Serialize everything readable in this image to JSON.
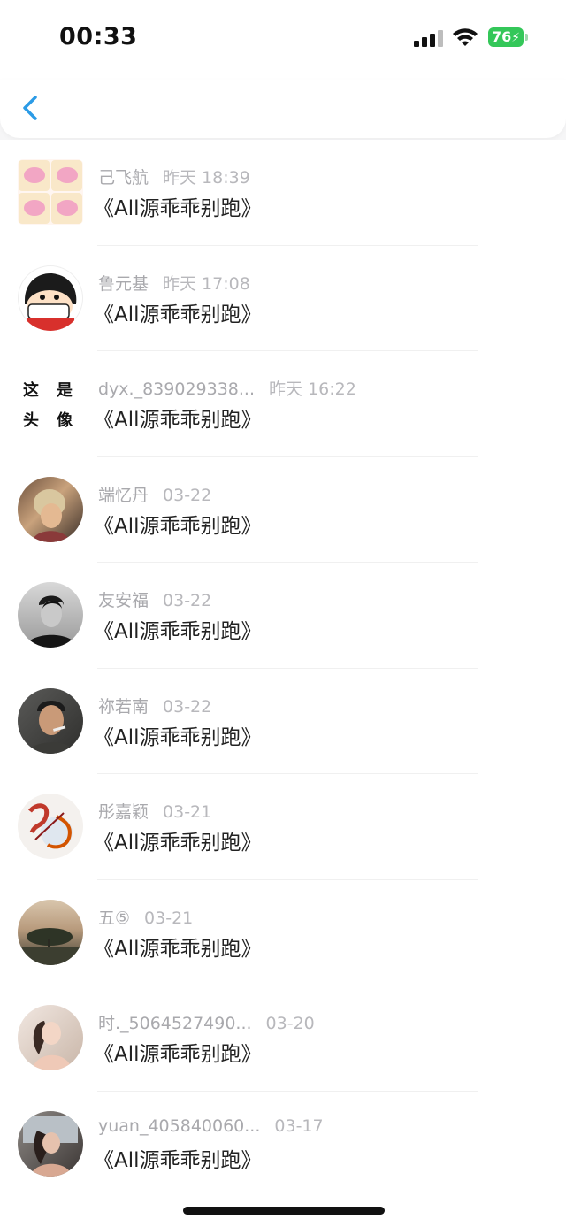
{
  "status_bar": {
    "time": "00:33",
    "battery": "76",
    "icons": [
      "signal-icon",
      "wifi-icon",
      "battery-charging-icon"
    ]
  },
  "nav": {
    "back_icon": "chevron-left-icon",
    "accent_color": "#2b9be6"
  },
  "messages": [
    {
      "name": "己飞航",
      "date": "昨天 18:39",
      "text": "《All源乖乖别跑》"
    },
    {
      "name": "鲁元基",
      "date": "昨天 17:08",
      "text": "《All源乖乖别跑》"
    },
    {
      "name": "dyx._839029338...",
      "date": "昨天 16:22",
      "text": "《All源乖乖别跑》",
      "avatar_text": [
        "这",
        "是",
        "头",
        "像"
      ]
    },
    {
      "name": "端忆丹",
      "date": "03-22",
      "text": "《All源乖乖别跑》"
    },
    {
      "name": "友安福",
      "date": "03-22",
      "text": "《All源乖乖别跑》"
    },
    {
      "name": "祢若南",
      "date": "03-22",
      "text": "《All源乖乖别跑》"
    },
    {
      "name": "彤嘉颖",
      "date": "03-21",
      "text": "《All源乖乖别跑》"
    },
    {
      "name": "五⑤",
      "date": "03-21",
      "text": "《All源乖乖别跑》"
    },
    {
      "name": "时._5064527490...",
      "date": "03-20",
      "text": "《All源乖乖别跑》"
    },
    {
      "name": "yuan_405840060...",
      "date": "03-17",
      "text": "《All源乖乖别跑》"
    }
  ]
}
